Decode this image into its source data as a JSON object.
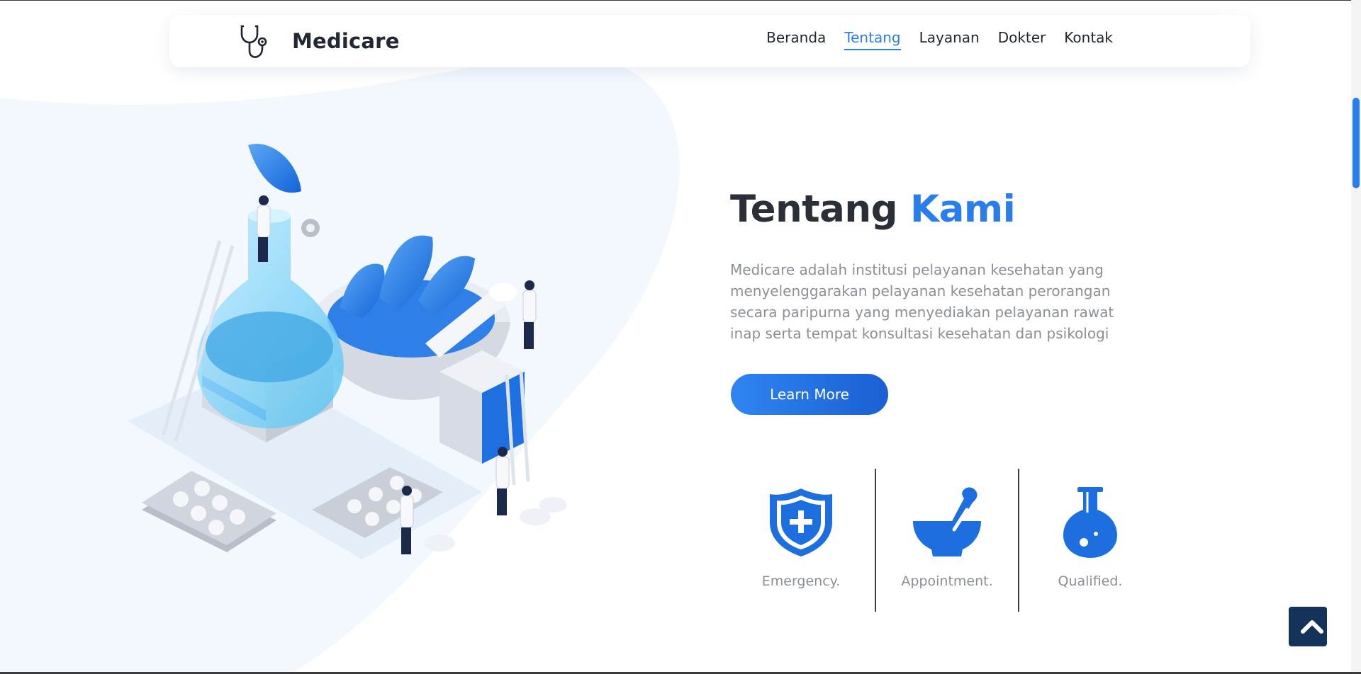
{
  "brand": {
    "name": "Medicare",
    "icon": "stethoscope-icon"
  },
  "nav": {
    "items": [
      {
        "label": "Beranda",
        "active": false
      },
      {
        "label": "Tentang",
        "active": true
      },
      {
        "label": "Layanan",
        "active": false
      },
      {
        "label": "Dokter",
        "active": false
      },
      {
        "label": "Kontak",
        "active": false
      }
    ]
  },
  "about": {
    "title_main": "Tentang",
    "title_accent": "Kami",
    "description": "Medicare adalah institusi pelayanan kesehatan yang menyelenggarakan pelayanan kesehatan perorangan secara paripurna yang menyediakan pelayanan rawat inap serta tempat konsultasi kesehatan dan psikologi",
    "button_label": "Learn More"
  },
  "features": [
    {
      "label": "Emergency.",
      "icon": "shield-plus-icon"
    },
    {
      "label": "Appointment.",
      "icon": "mortar-pestle-icon"
    },
    {
      "label": "Qualified.",
      "icon": "flask-icon"
    }
  ],
  "back_to_top": {
    "icon": "chevron-up-icon"
  },
  "colors": {
    "accent": "#2b7de9",
    "text_dark": "#2b2f38",
    "text_muted": "#8b8f96",
    "button_top": "#15335a",
    "blob": "#f3f8fe"
  }
}
